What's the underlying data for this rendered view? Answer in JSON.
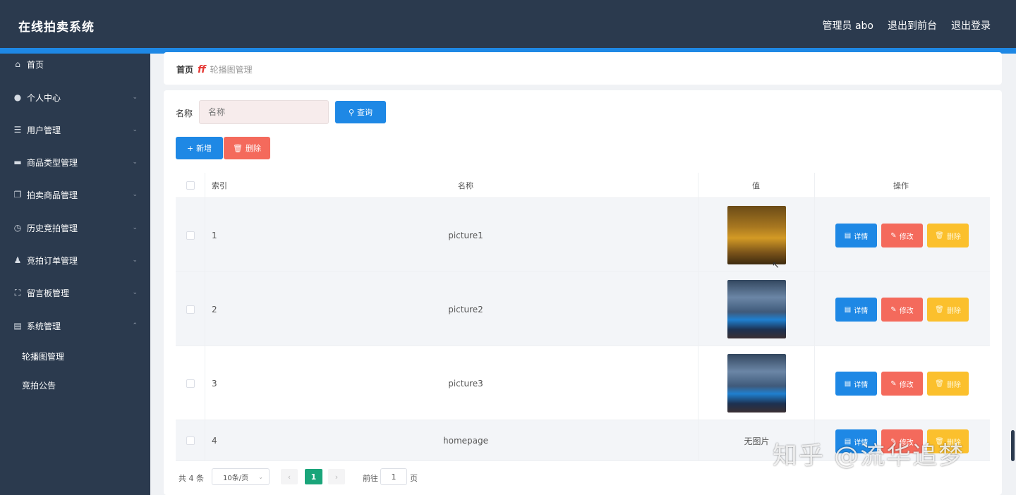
{
  "header": {
    "app_title": "在线拍卖系统",
    "user_label": "管理员 abo",
    "front_link": "退出到前台",
    "logout_link": "退出登录"
  },
  "sidebar": {
    "items": [
      {
        "label": "首页",
        "icon": "home-icon",
        "glyph": "⌂"
      },
      {
        "label": "个人中心",
        "icon": "user-icon",
        "glyph": "●"
      },
      {
        "label": "用户管理",
        "icon": "sliders-icon",
        "glyph": "☰"
      },
      {
        "label": "商品类型管理",
        "icon": "monitor-icon",
        "glyph": "▬"
      },
      {
        "label": "拍卖商品管理",
        "icon": "copy-icon",
        "glyph": "❐"
      },
      {
        "label": "历史竞拍管理",
        "icon": "clock-icon",
        "glyph": "◷"
      },
      {
        "label": "竞拍订单管理",
        "icon": "person-icon",
        "glyph": "♟"
      },
      {
        "label": "留言板管理",
        "icon": "fullscreen-icon",
        "glyph": "⛶"
      },
      {
        "label": "系统管理",
        "icon": "clipboard-icon",
        "glyph": "▤"
      }
    ],
    "sub_items": [
      "轮播图管理",
      "竞拍公告"
    ]
  },
  "breadcrumb": {
    "home": "首页",
    "separator": "ff",
    "current": "轮播图管理"
  },
  "search": {
    "label": "名称",
    "placeholder": "名称",
    "button": "查询"
  },
  "toolbar": {
    "add": "新增",
    "delete": "删除"
  },
  "table": {
    "columns": [
      "索引",
      "名称",
      "值",
      "操作"
    ],
    "rows": [
      {
        "index": "1",
        "name": "picture1",
        "value": "image",
        "thumb": "p1"
      },
      {
        "index": "2",
        "name": "picture2",
        "value": "image",
        "thumb": "p2"
      },
      {
        "index": "3",
        "name": "picture3",
        "value": "image",
        "thumb": "p2"
      },
      {
        "index": "4",
        "name": "homepage",
        "value": "无图片",
        "thumb": ""
      }
    ],
    "actions": {
      "detail": "详情",
      "edit": "修改",
      "delete": "删除"
    }
  },
  "pagination": {
    "total": "共 4 条",
    "page_size": "10条/页",
    "current_page": "1",
    "goto_label": "前往",
    "goto_value": "1",
    "page_unit": "页"
  },
  "watermark": "知乎 @流华追梦",
  "colors": {
    "header_bg": "#2b3a4e",
    "primary": "#1e88e5",
    "danger": "#f46a5c",
    "warning": "#fbc02d",
    "pager_active": "#1aa57a"
  }
}
